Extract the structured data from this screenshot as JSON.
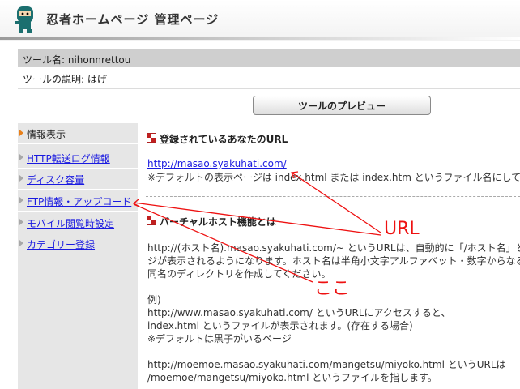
{
  "header": {
    "title": "忍者ホームページ 管理ページ",
    "logo_icon": "ninja-logo-icon"
  },
  "tool": {
    "name_label": "ツール名: nihonnrettou",
    "description_label": "ツールの説明: はげ"
  },
  "preview_button": "ツールのプレビュー",
  "sidebar": {
    "items": [
      {
        "label": "情報表示",
        "active": true
      },
      {
        "label": "HTTP転送ログ情報",
        "active": false
      },
      {
        "label": "ディスク容量",
        "active": false
      },
      {
        "label": "FTP情報・アップロード",
        "active": false
      },
      {
        "label": "モバイル閲覧時設定",
        "active": false
      },
      {
        "label": "カテゴリー登録",
        "active": false
      }
    ]
  },
  "main": {
    "section1": {
      "title": "登録されているあなたのURL",
      "url": "http://masao.syakuhati.com/",
      "note": "※デフォルトの表示ページは index.html または index.htm というファイル名にして下さ"
    },
    "section2": {
      "title": "バーチャルホスト機能とは",
      "para_line1": "http://(ホスト名).masao.syakuhati.com/~ というURLは、自動的に「/ホスト名」という",
      "para_line2": "ジが表示されるようになります。ホスト名は半角小文字アルファベット・数字からなる任",
      "para_line3": "同名のディレクトリを作成してください。",
      "example_label": "例)",
      "ex1_line1": "http://www.masao.syakuhati.com/ というURLにアクセスすると、",
      "ex1_line2": "index.html というファイルが表示されます。(存在する場合)",
      "ex1_line3": "※デフォルトは黒子がいるページ",
      "ex2_line1": "http://moemoe.masao.syakuhati.com/mangetsu/miyoko.html というURLは",
      "ex2_line2": "/moemoe/mangetsu/miyoko.html  というファイルを指します。"
    }
  },
  "annotations": {
    "url_label": "URL",
    "koko_label": "ここ",
    "color": "#ee1111"
  }
}
